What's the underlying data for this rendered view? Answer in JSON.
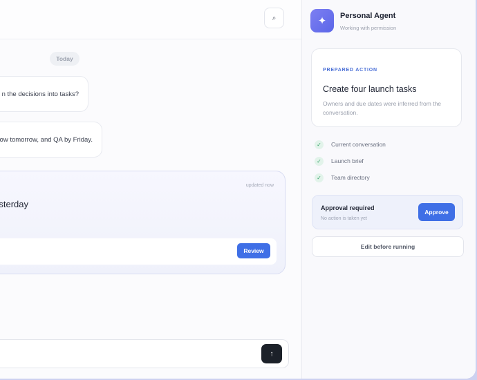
{
  "chat": {
    "date_divider": "Today",
    "messages": [
      {
        "text": "n the decisions into tasks?"
      },
      {
        "text": "ow tomorrow, and QA by Friday."
      }
    ],
    "card": {
      "updated": "updated now",
      "title": "sterday",
      "review_label": "Review"
    },
    "composer": {
      "send_icon": "↑"
    }
  },
  "header": {
    "search_icon": "⌕"
  },
  "panel": {
    "agent_icon": "✦",
    "agent_name": "Personal Agent",
    "agent_status": "Working with permission",
    "action": {
      "tag": "PREPARED ACTION",
      "title": "Create four launch tasks",
      "description": "Owners and due dates were inferred from the conversation."
    },
    "context_items": [
      {
        "label": "Current conversation",
        "check": "✓"
      },
      {
        "label": "Launch brief",
        "check": "✓"
      },
      {
        "label": "Team directory",
        "check": "✓"
      }
    ],
    "approval": {
      "title": "Approval required",
      "subtitle": "No action is taken yet",
      "approve_label": "Approve"
    },
    "edit_label": "Edit before running"
  },
  "colors": {
    "accent": "#3f6fe6",
    "agent_gradient_start": "#7d7ff2",
    "agent_gradient_end": "#5b66e8",
    "check_green": "#39a56b",
    "send_dark": "#1c2129"
  }
}
